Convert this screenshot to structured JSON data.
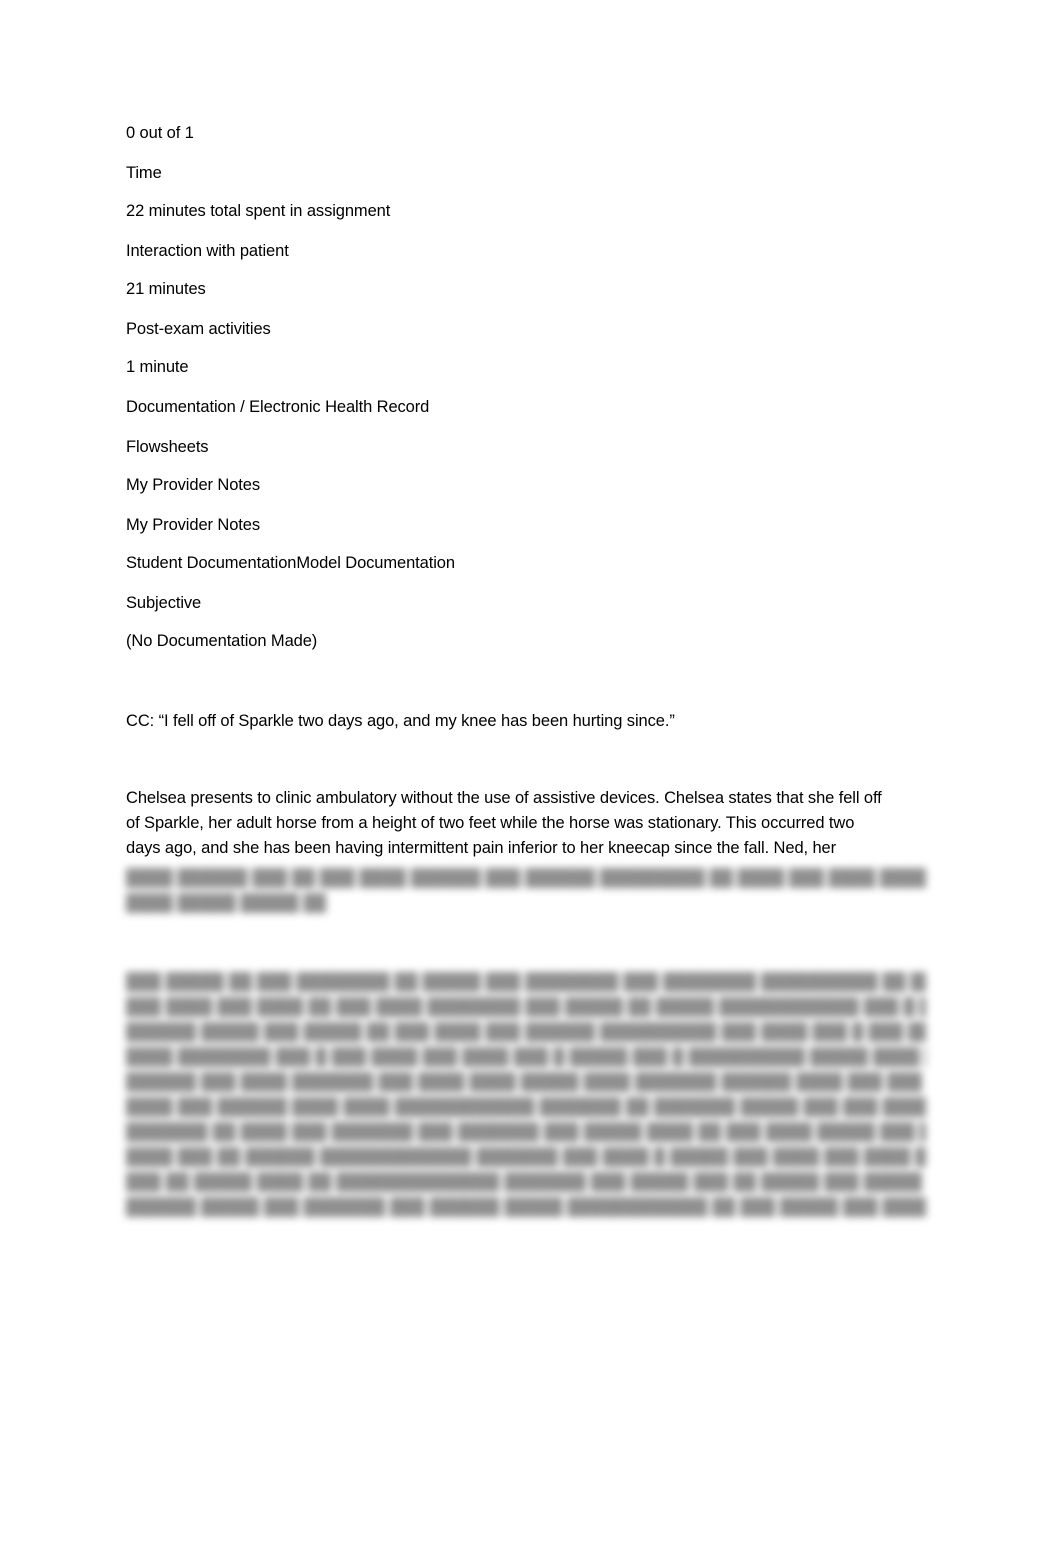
{
  "document": {
    "score": "0 out of 1",
    "time_heading": "Time",
    "total_time": "22 minutes total spent in assignment",
    "interaction_label": "Interaction with patient",
    "interaction_time": "21 minutes",
    "post_exam_label": "Post-exam activities",
    "post_exam_time": "1 minute",
    "documentation_heading": "Documentation / Electronic Health Record",
    "flowsheets": "Flowsheets",
    "provider_notes_1": "My Provider Notes",
    "provider_notes_2": "My Provider Notes",
    "doc_tabs": "Student DocumentationModel Documentation",
    "subjective_heading": "Subjective",
    "no_documentation": "(No Documentation Made)",
    "chief_complaint": "CC: “I fell off of Sparkle two days ago, and my knee has been hurting since.”",
    "hpi_lines": [
      "Chelsea presents to clinic ambulatory without the use of assistive devices. Chelsea states that she fell off",
      "of Sparkle, her adult horse from a height of two feet while the horse was stationary. This occurred two",
      "days ago, and she has been having intermittent pain inferior to her kneecap since the fall. Ned, her"
    ],
    "blurred_notice": "[blurred content]"
  }
}
